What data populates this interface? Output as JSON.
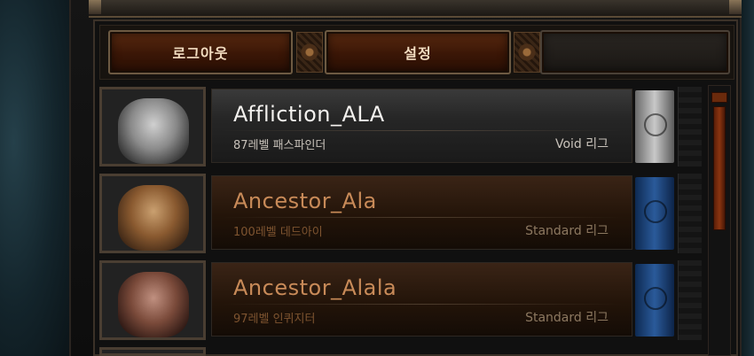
{
  "top_buttons": {
    "logout_label": "로그아웃",
    "settings_label": "설정"
  },
  "characters": [
    {
      "name": "Affliction_ALA",
      "level_class": "87레벨 패스파인더",
      "league": "Void 리그",
      "selected": true,
      "banner_color": "#9a9a9a"
    },
    {
      "name": "Ancestor_Ala",
      "level_class": "100레벨 데드아이",
      "league": "Standard 리그",
      "selected": false,
      "banner_color": "#2a5a9a"
    },
    {
      "name": "Ancestor_Alala",
      "level_class": "97레벨 인퀴지터",
      "league": "Standard 리그",
      "selected": false,
      "banner_color": "#2a5a9a"
    }
  ],
  "colors": {
    "button_bg": "#3a1606",
    "name_selected": "#f3f1ee",
    "name_normal": "#c88a58",
    "scroll_thumb": "#8a3410"
  }
}
